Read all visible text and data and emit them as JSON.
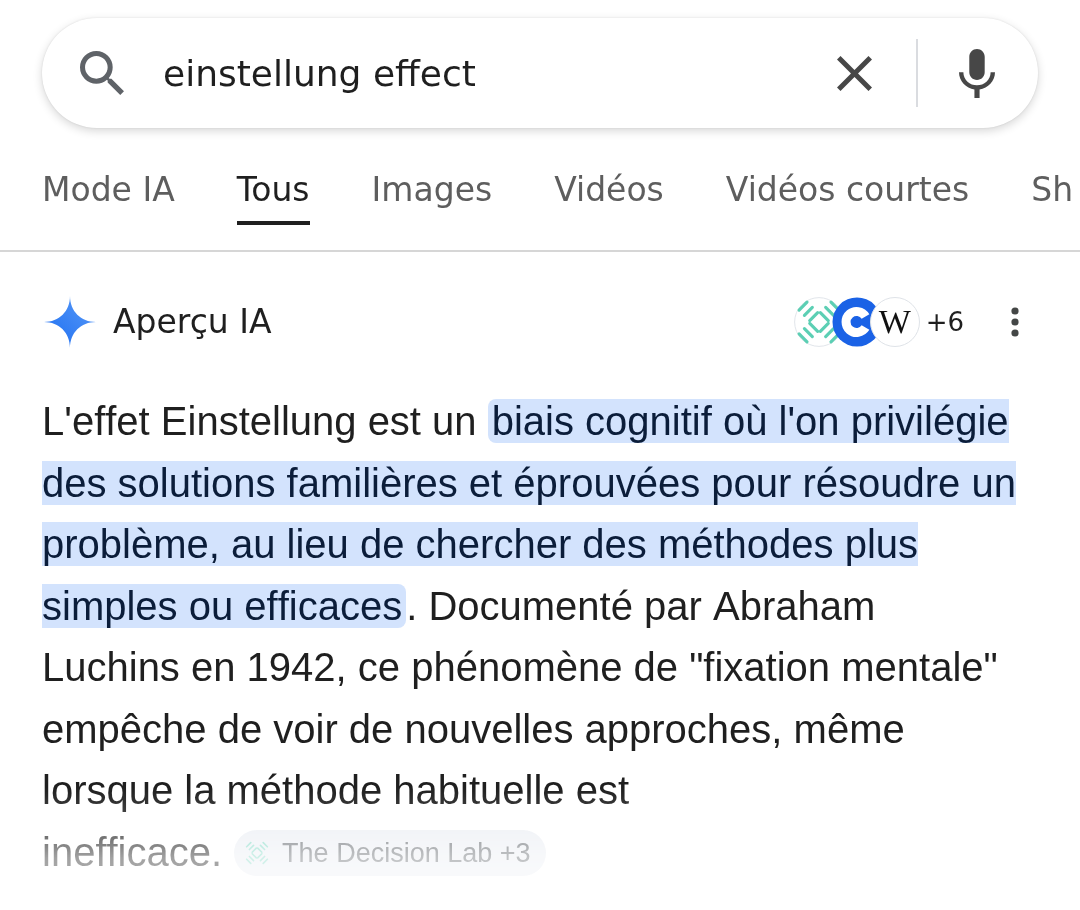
{
  "search": {
    "value": "einstellung effect"
  },
  "tabs": [
    {
      "label": "Mode IA",
      "selected": false
    },
    {
      "label": "Tous",
      "selected": true
    },
    {
      "label": "Images",
      "selected": false
    },
    {
      "label": "Vidéos",
      "selected": false
    },
    {
      "label": "Vidéos courtes",
      "selected": false
    },
    {
      "label": "Sh",
      "selected": false
    }
  ],
  "ai_overview": {
    "title": "Aperçu IA",
    "sources": {
      "favicons": [
        {
          "kind": "pattern"
        },
        {
          "kind": "ring"
        },
        {
          "kind": "letter",
          "letter": "W"
        }
      ],
      "more": "+6"
    },
    "summary": [
      {
        "text": "L'effet Einstellung est un ",
        "highlighted": false
      },
      {
        "text": "biais cognitif où l'on privilégie des solutions familières et éprouvées pour résoudre un problème, au lieu de chercher des méthodes plus simples ou efficaces",
        "highlighted": true
      },
      {
        "text": ". Documenté par Abraham Luchins en 1942, ce phénomène de \"fixation mentale\" empêche de voir de nouvelles approches, même lorsque la méthode habituelle est inefficace.",
        "highlighted": false
      }
    ],
    "source_chip": {
      "label": "The Decision Lab +3"
    }
  }
}
